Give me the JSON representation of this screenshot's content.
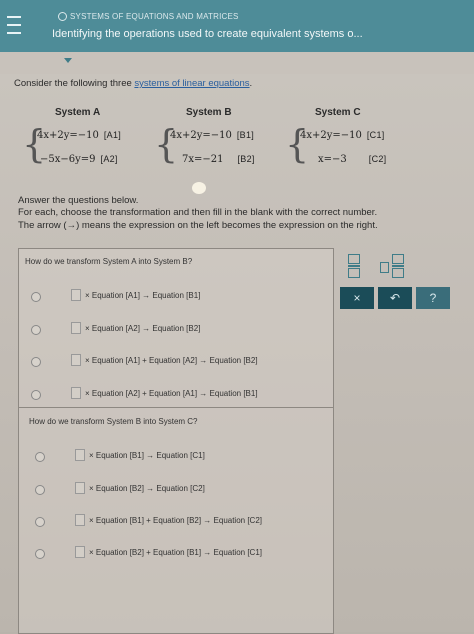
{
  "header": {
    "breadcrumb": "SYSTEMS OF EQUATIONS AND MATRICES",
    "title": "Identifying the operations used to create equivalent systems o..."
  },
  "intro": {
    "text": "Consider the following three ",
    "link": "systems of linear equations",
    "end": "."
  },
  "systems": [
    {
      "title": "System A",
      "eq1": "4x+2y=−10",
      "tag1": "[A1]",
      "eq2": "−5x−6y=9",
      "tag2": "[A2]"
    },
    {
      "title": "System B",
      "eq1": "4x+2y=−10",
      "tag1": "[B1]",
      "eq2": "7x=−21",
      "tag2": "[B2]"
    },
    {
      "title": "System C",
      "eq1": "4x+2y=−10",
      "tag1": "[C1]",
      "eq2": "x=−3",
      "tag2": "[C2]"
    }
  ],
  "instructions": {
    "line1": "Answer the questions below.",
    "line2": "For each, choose the transformation and then fill in the blank with the correct number.",
    "line3": "The arrow (→) means the expression on the left becomes the expression on the right."
  },
  "question1": {
    "prompt": "How do we transform System A into System B?",
    "options": [
      "× Equation [A1] → Equation [B1]",
      "× Equation [A2] → Equation [B2]",
      "× Equation [A1] + Equation [A2] → Equation [B2]",
      "× Equation [A2] + Equation [A1] → Equation [B1]"
    ]
  },
  "question2": {
    "prompt": "How do we transform System B into System C?",
    "options": [
      "× Equation [B1] → Equation [C1]",
      "× Equation [B2] → Equation [C2]",
      "× Equation [B1] + Equation [B2] → Equation [C2]",
      "× Equation [B2] + Equation [B1] → Equation [C1]"
    ]
  },
  "tools": {
    "clear_label": "×",
    "undo_label": "↶",
    "help_label": "?"
  },
  "colors": {
    "header": "#4e8c98",
    "tool_button": "#1b4c58"
  }
}
